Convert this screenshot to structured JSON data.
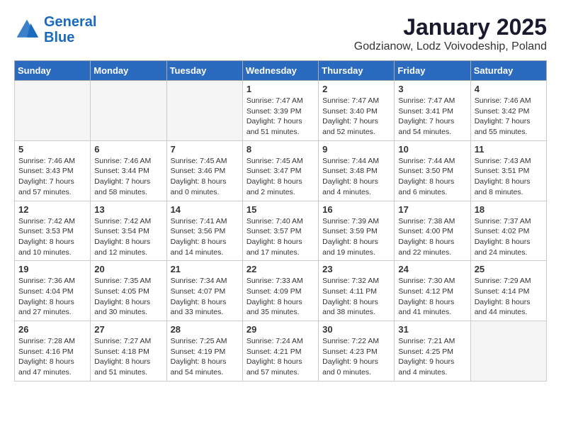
{
  "logo": {
    "line1": "General",
    "line2": "Blue"
  },
  "title": "January 2025",
  "subtitle": "Godzianow, Lodz Voivodeship, Poland",
  "columns": [
    "Sunday",
    "Monday",
    "Tuesday",
    "Wednesday",
    "Thursday",
    "Friday",
    "Saturday"
  ],
  "weeks": [
    [
      {
        "day": "",
        "info": ""
      },
      {
        "day": "",
        "info": ""
      },
      {
        "day": "",
        "info": ""
      },
      {
        "day": "1",
        "info": "Sunrise: 7:47 AM\nSunset: 3:39 PM\nDaylight: 7 hours\nand 51 minutes."
      },
      {
        "day": "2",
        "info": "Sunrise: 7:47 AM\nSunset: 3:40 PM\nDaylight: 7 hours\nand 52 minutes."
      },
      {
        "day": "3",
        "info": "Sunrise: 7:47 AM\nSunset: 3:41 PM\nDaylight: 7 hours\nand 54 minutes."
      },
      {
        "day": "4",
        "info": "Sunrise: 7:46 AM\nSunset: 3:42 PM\nDaylight: 7 hours\nand 55 minutes."
      }
    ],
    [
      {
        "day": "5",
        "info": "Sunrise: 7:46 AM\nSunset: 3:43 PM\nDaylight: 7 hours\nand 57 minutes."
      },
      {
        "day": "6",
        "info": "Sunrise: 7:46 AM\nSunset: 3:44 PM\nDaylight: 7 hours\nand 58 minutes."
      },
      {
        "day": "7",
        "info": "Sunrise: 7:45 AM\nSunset: 3:46 PM\nDaylight: 8 hours\nand 0 minutes."
      },
      {
        "day": "8",
        "info": "Sunrise: 7:45 AM\nSunset: 3:47 PM\nDaylight: 8 hours\nand 2 minutes."
      },
      {
        "day": "9",
        "info": "Sunrise: 7:44 AM\nSunset: 3:48 PM\nDaylight: 8 hours\nand 4 minutes."
      },
      {
        "day": "10",
        "info": "Sunrise: 7:44 AM\nSunset: 3:50 PM\nDaylight: 8 hours\nand 6 minutes."
      },
      {
        "day": "11",
        "info": "Sunrise: 7:43 AM\nSunset: 3:51 PM\nDaylight: 8 hours\nand 8 minutes."
      }
    ],
    [
      {
        "day": "12",
        "info": "Sunrise: 7:42 AM\nSunset: 3:53 PM\nDaylight: 8 hours\nand 10 minutes."
      },
      {
        "day": "13",
        "info": "Sunrise: 7:42 AM\nSunset: 3:54 PM\nDaylight: 8 hours\nand 12 minutes."
      },
      {
        "day": "14",
        "info": "Sunrise: 7:41 AM\nSunset: 3:56 PM\nDaylight: 8 hours\nand 14 minutes."
      },
      {
        "day": "15",
        "info": "Sunrise: 7:40 AM\nSunset: 3:57 PM\nDaylight: 8 hours\nand 17 minutes."
      },
      {
        "day": "16",
        "info": "Sunrise: 7:39 AM\nSunset: 3:59 PM\nDaylight: 8 hours\nand 19 minutes."
      },
      {
        "day": "17",
        "info": "Sunrise: 7:38 AM\nSunset: 4:00 PM\nDaylight: 8 hours\nand 22 minutes."
      },
      {
        "day": "18",
        "info": "Sunrise: 7:37 AM\nSunset: 4:02 PM\nDaylight: 8 hours\nand 24 minutes."
      }
    ],
    [
      {
        "day": "19",
        "info": "Sunrise: 7:36 AM\nSunset: 4:04 PM\nDaylight: 8 hours\nand 27 minutes."
      },
      {
        "day": "20",
        "info": "Sunrise: 7:35 AM\nSunset: 4:05 PM\nDaylight: 8 hours\nand 30 minutes."
      },
      {
        "day": "21",
        "info": "Sunrise: 7:34 AM\nSunset: 4:07 PM\nDaylight: 8 hours\nand 33 minutes."
      },
      {
        "day": "22",
        "info": "Sunrise: 7:33 AM\nSunset: 4:09 PM\nDaylight: 8 hours\nand 35 minutes."
      },
      {
        "day": "23",
        "info": "Sunrise: 7:32 AM\nSunset: 4:11 PM\nDaylight: 8 hours\nand 38 minutes."
      },
      {
        "day": "24",
        "info": "Sunrise: 7:30 AM\nSunset: 4:12 PM\nDaylight: 8 hours\nand 41 minutes."
      },
      {
        "day": "25",
        "info": "Sunrise: 7:29 AM\nSunset: 4:14 PM\nDaylight: 8 hours\nand 44 minutes."
      }
    ],
    [
      {
        "day": "26",
        "info": "Sunrise: 7:28 AM\nSunset: 4:16 PM\nDaylight: 8 hours\nand 47 minutes."
      },
      {
        "day": "27",
        "info": "Sunrise: 7:27 AM\nSunset: 4:18 PM\nDaylight: 8 hours\nand 51 minutes."
      },
      {
        "day": "28",
        "info": "Sunrise: 7:25 AM\nSunset: 4:19 PM\nDaylight: 8 hours\nand 54 minutes."
      },
      {
        "day": "29",
        "info": "Sunrise: 7:24 AM\nSunset: 4:21 PM\nDaylight: 8 hours\nand 57 minutes."
      },
      {
        "day": "30",
        "info": "Sunrise: 7:22 AM\nSunset: 4:23 PM\nDaylight: 9 hours\nand 0 minutes."
      },
      {
        "day": "31",
        "info": "Sunrise: 7:21 AM\nSunset: 4:25 PM\nDaylight: 9 hours\nand 4 minutes."
      },
      {
        "day": "",
        "info": ""
      }
    ]
  ]
}
